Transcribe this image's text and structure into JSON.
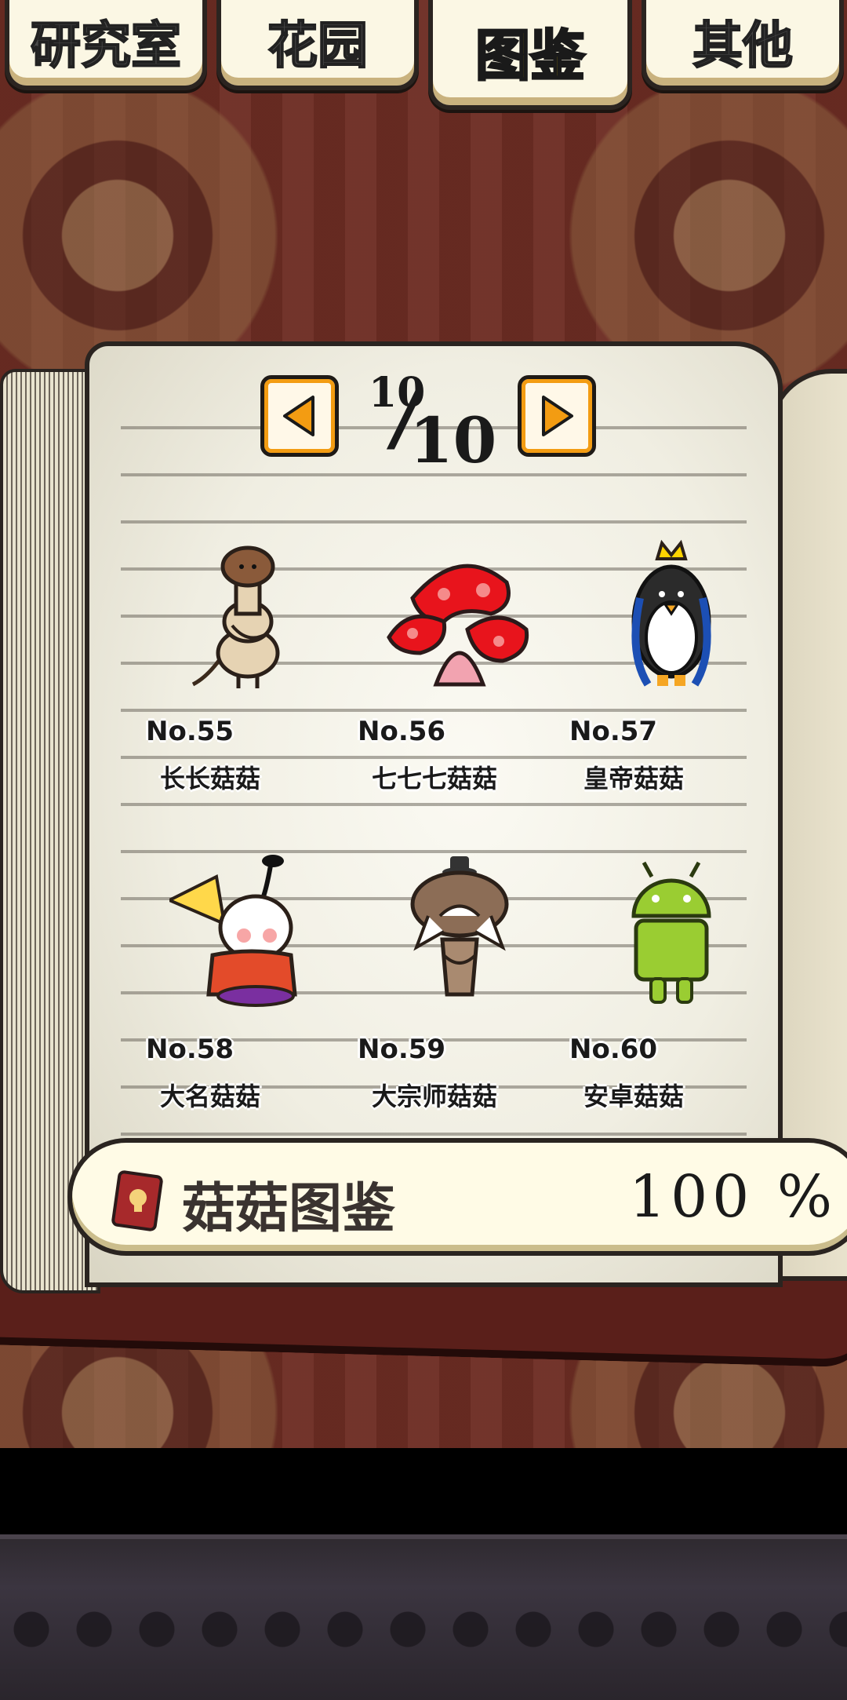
{
  "tabs": [
    {
      "label": "研究室",
      "active": false
    },
    {
      "label": "花园",
      "active": false
    },
    {
      "label": "图鉴",
      "active": true
    },
    {
      "label": "其他",
      "active": false
    }
  ],
  "pager": {
    "current": "10",
    "total": "10"
  },
  "entries": [
    {
      "no": "No.55",
      "name": "长长菇菇"
    },
    {
      "no": "No.56",
      "name": "七七七菇菇"
    },
    {
      "no": "No.57",
      "name": "皇帝菇菇"
    },
    {
      "no": "No.58",
      "name": "大名菇菇"
    },
    {
      "no": "No.59",
      "name": "大宗师菇菇"
    },
    {
      "no": "No.60",
      "name": "安卓菇菇"
    }
  ],
  "collection": {
    "label": "菇菇图鉴",
    "percent": "100 %"
  },
  "colors": {
    "tab_active": "#ffd400",
    "arrow": "#f39c12",
    "book_red": "#5a1f1a"
  }
}
